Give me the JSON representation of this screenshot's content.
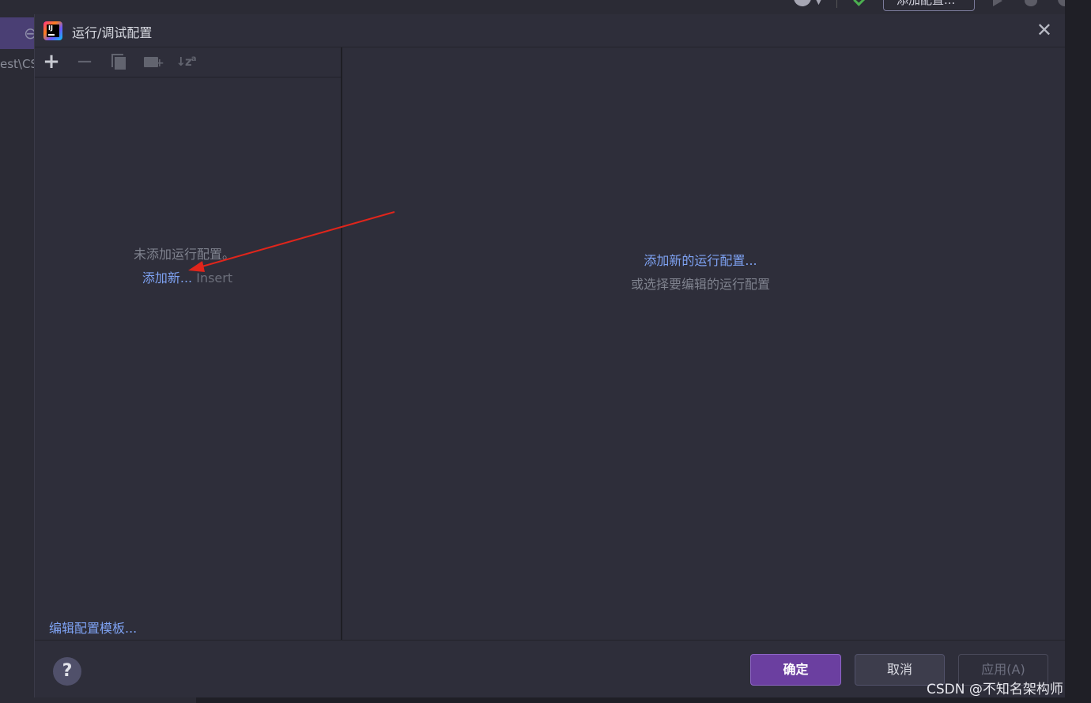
{
  "ide": {
    "path_fragment": "est\\CS",
    "toolbar_add_config": "添加配置..."
  },
  "dialog": {
    "title": "运行/调试配置",
    "close_glyph": "✕",
    "toolbar": {
      "add_glyph": "+",
      "remove_glyph": "−"
    },
    "left_panel": {
      "empty_message": "未添加运行配置。",
      "add_new_label": "添加新...",
      "add_new_shortcut": "Insert",
      "edit_templates_label": "编辑配置模板..."
    },
    "right_panel": {
      "add_new_config_label": "添加新的运行配置...",
      "select_hint": "或选择要编辑的运行配置"
    },
    "footer": {
      "help_label": "?",
      "ok_label": "确定",
      "cancel_label": "取消",
      "apply_label": "应用(A)"
    }
  },
  "watermark": "CSDN @不知名架构师",
  "colors": {
    "dialog_bg": "#2e2e3a",
    "link": "#7ea2f2",
    "ok_button": "#6b3fa0",
    "annotation_arrow": "#e0251b"
  }
}
